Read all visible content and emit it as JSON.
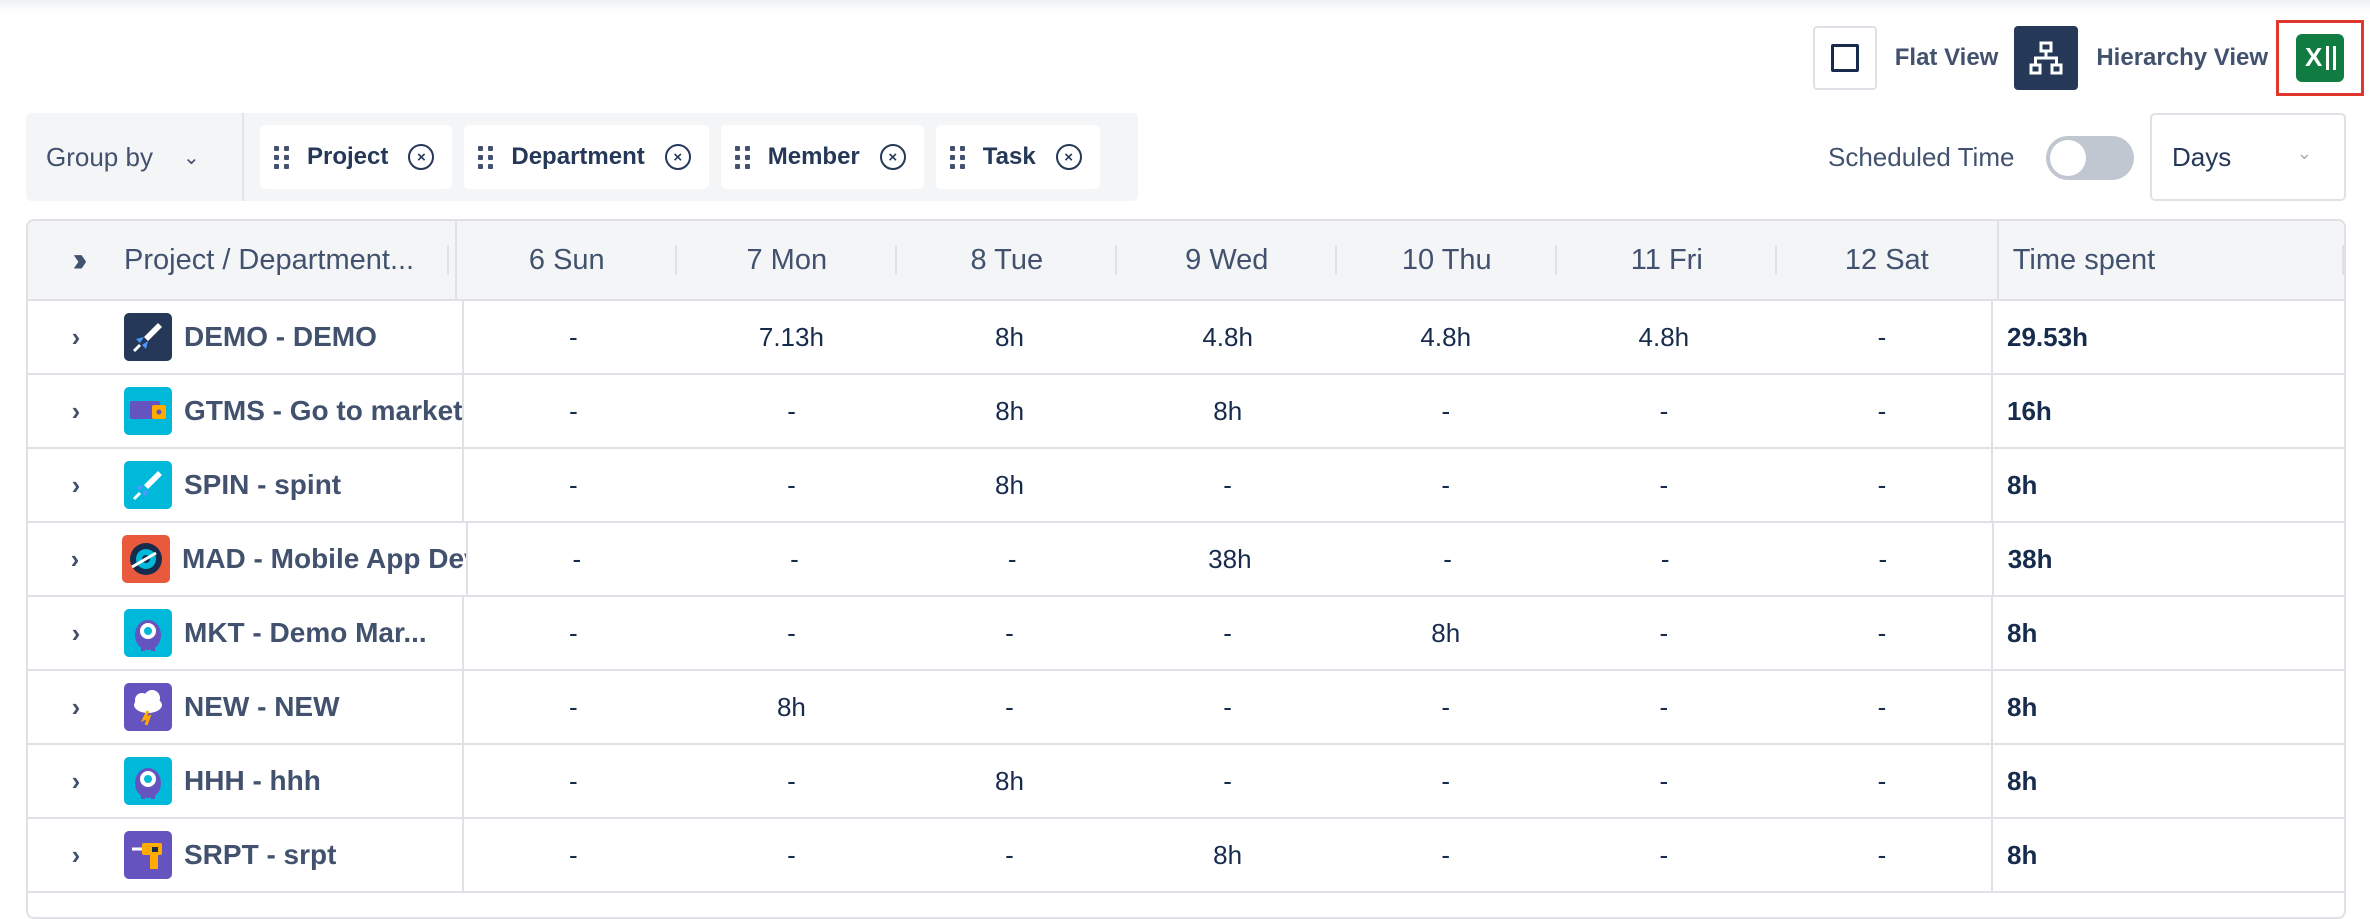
{
  "view_toolbar": {
    "flat_view_label": "Flat View",
    "hierarchy_view_label": "Hierarchy View",
    "export_icon": "excel-icon"
  },
  "group_bar": {
    "label": "Group by",
    "chips": [
      "Project",
      "Department",
      "Member",
      "Task"
    ]
  },
  "scheduled_time": {
    "label": "Scheduled Time",
    "enabled": false
  },
  "period_select": {
    "value": "Days"
  },
  "table": {
    "first_column_header": "Project / Department...",
    "day_headers": [
      "6 Sun",
      "7 Mon",
      "8 Tue",
      "9 Wed",
      "10 Thu",
      "11 Fri",
      "12 Sat"
    ],
    "total_header": "Time spent",
    "rows": [
      {
        "name": "DEMO - DEMO",
        "avatar": "rocket-icon",
        "avatar_color": "#253858",
        "days": [
          "-",
          "7.13h",
          "8h",
          "4.8h",
          "4.8h",
          "4.8h",
          "-"
        ],
        "total": "29.53h"
      },
      {
        "name": "GTMS - Go to market",
        "avatar": "wallet-icon",
        "avatar_color": "#00b8d9",
        "days": [
          "-",
          "-",
          "8h",
          "8h",
          "-",
          "-",
          "-"
        ],
        "total": "16h"
      },
      {
        "name": "SPIN - spint",
        "avatar": "rocket-icon",
        "avatar_color": "#00b8d9",
        "days": [
          "-",
          "-",
          "8h",
          "-",
          "-",
          "-",
          "-"
        ],
        "total": "8h"
      },
      {
        "name": "MAD - Mobile App Dev",
        "avatar": "disc-icon",
        "avatar_color": "#e85a3b",
        "days": [
          "-",
          "-",
          "-",
          "38h",
          "-",
          "-",
          "-"
        ],
        "total": "38h"
      },
      {
        "name": "MKT - Demo Mar...",
        "avatar": "monster-icon",
        "avatar_color": "#00b8d9",
        "days": [
          "-",
          "-",
          "-",
          "-",
          "8h",
          "-",
          "-"
        ],
        "total": "8h"
      },
      {
        "name": "NEW - NEW",
        "avatar": "storm-cloud-icon",
        "avatar_color": "#6554c0",
        "days": [
          "-",
          "8h",
          "-",
          "-",
          "-",
          "-",
          "-"
        ],
        "total": "8h"
      },
      {
        "name": "HHH - hhh",
        "avatar": "monster-icon",
        "avatar_color": "#00b8d9",
        "days": [
          "-",
          "-",
          "8h",
          "-",
          "-",
          "-",
          "-"
        ],
        "total": "8h"
      },
      {
        "name": "SRPT - srpt",
        "avatar": "drill-icon",
        "avatar_color": "#6554c0",
        "days": [
          "-",
          "-",
          "-",
          "8h",
          "-",
          "-",
          "-"
        ],
        "total": "8h"
      }
    ]
  }
}
